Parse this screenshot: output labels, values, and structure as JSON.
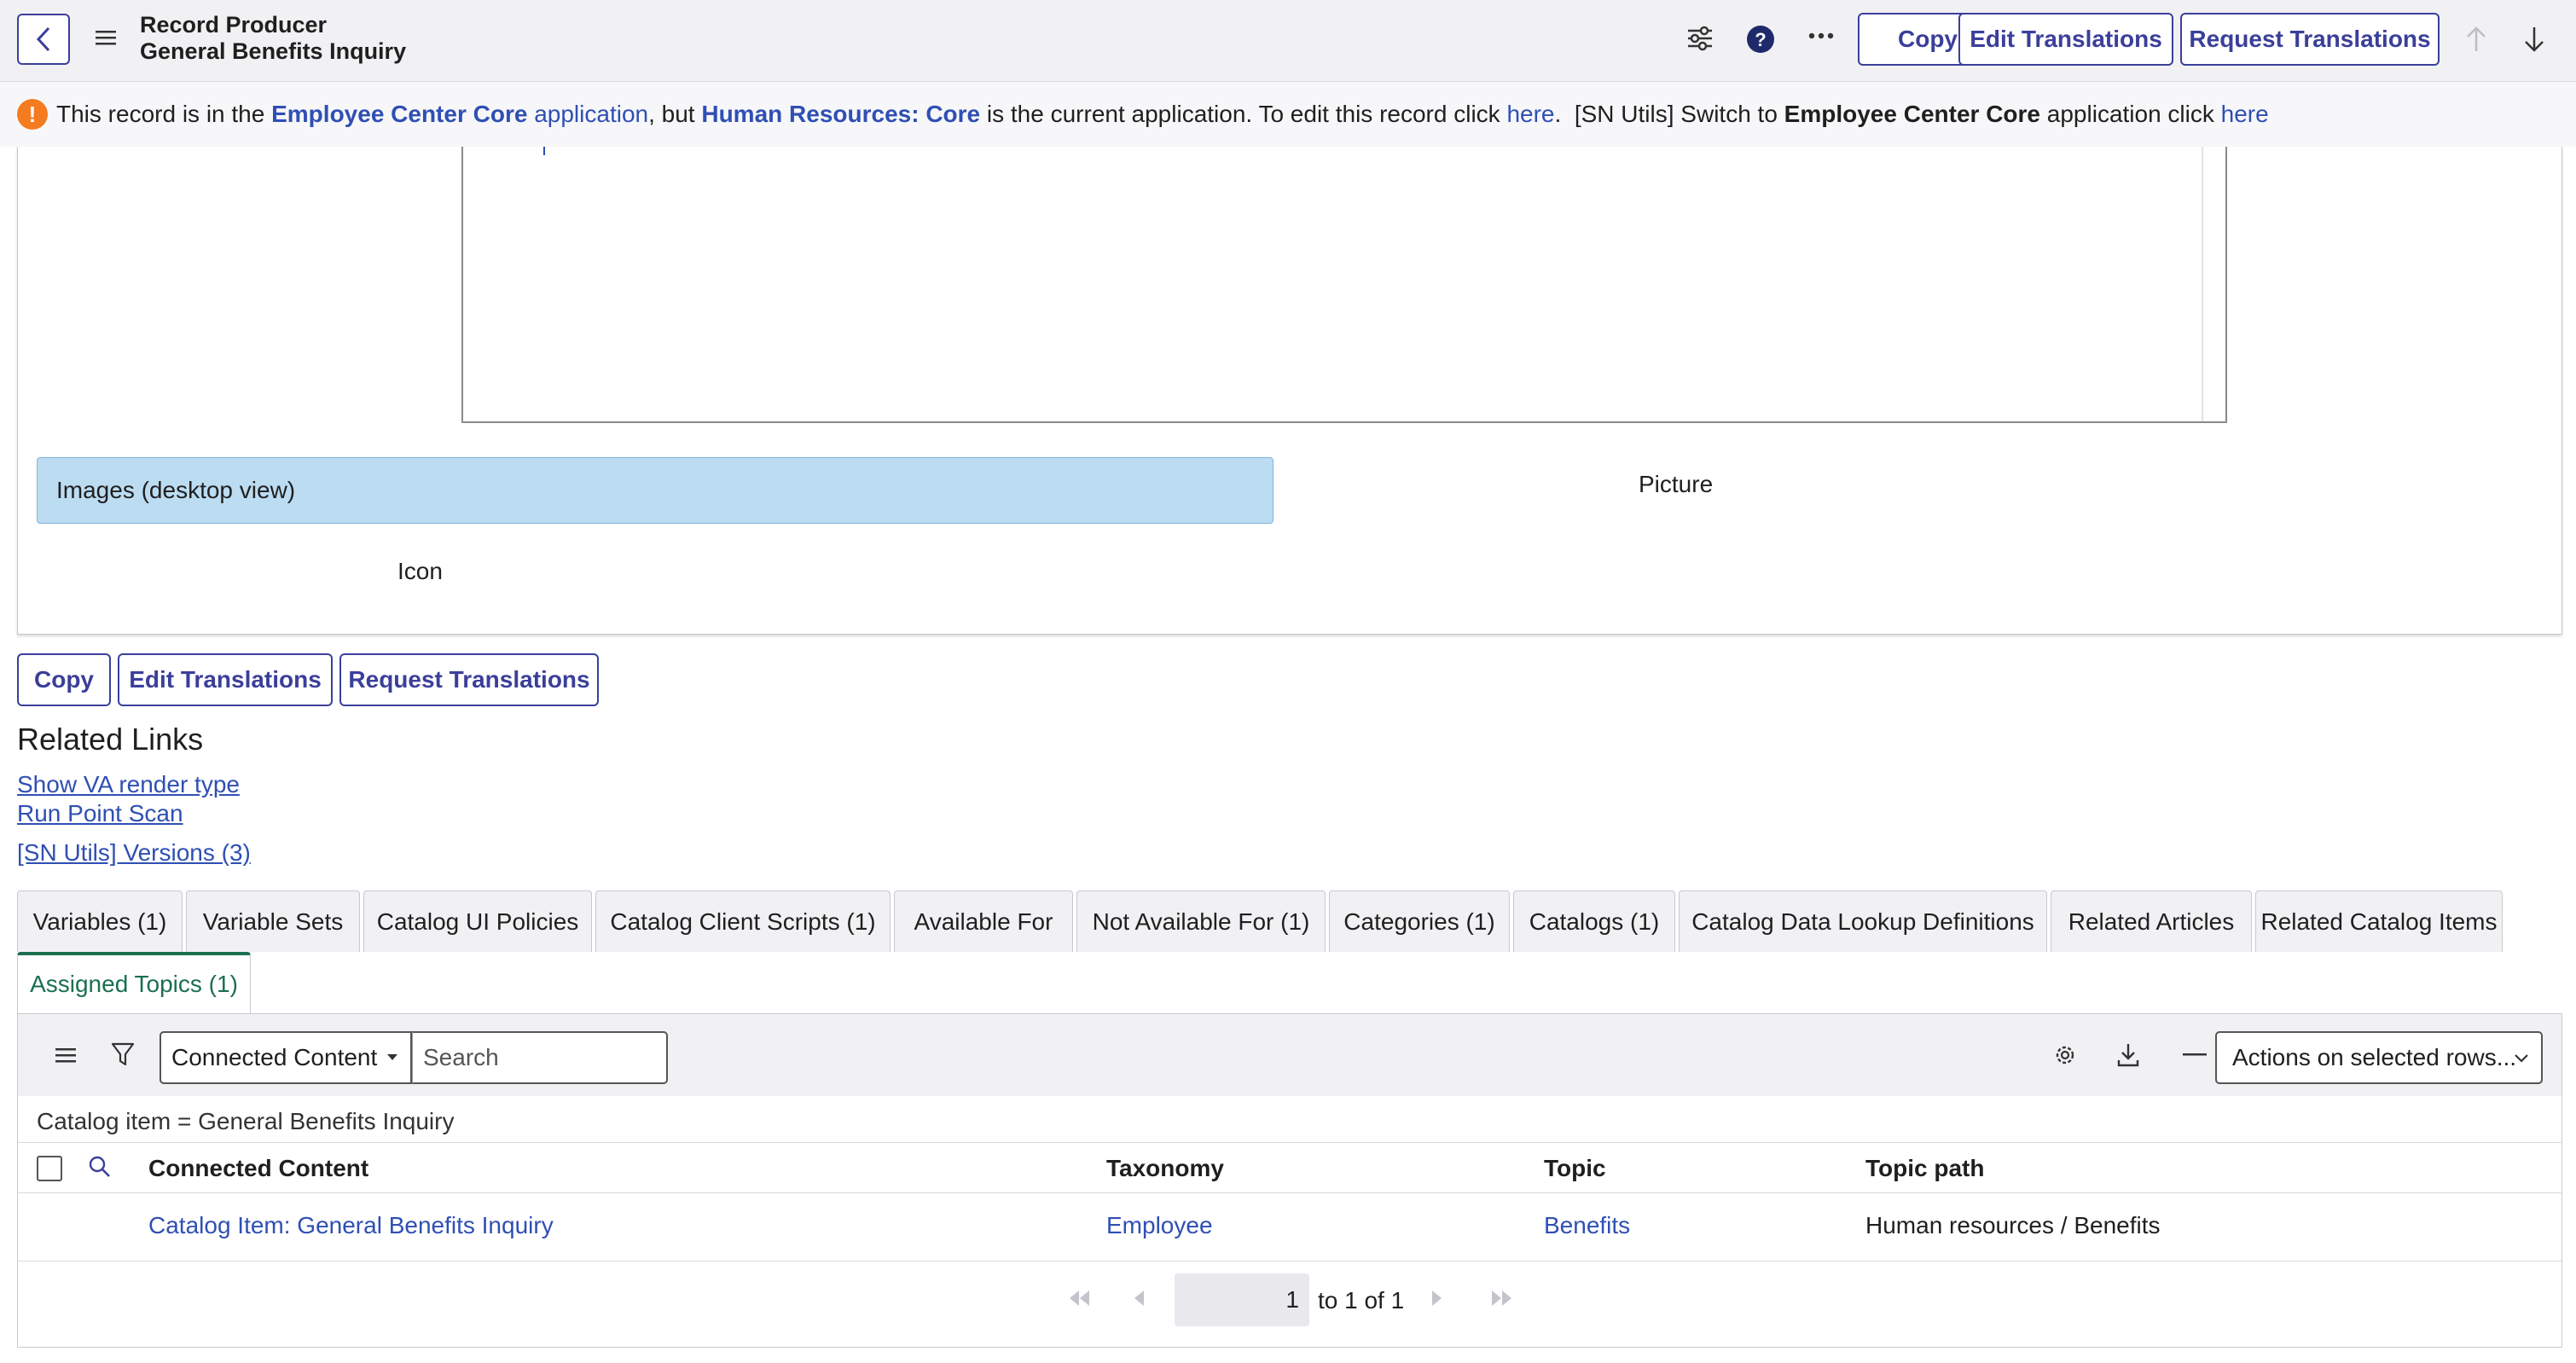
{
  "header": {
    "record_type": "Record Producer",
    "record_name": "General Benefits Inquiry",
    "buttons": {
      "copy": "Copy",
      "edit_translations": "Edit Translations",
      "request_translations": "Request Translations"
    }
  },
  "notice": {
    "icon_text": "!",
    "p1": "This record is in the ",
    "app1_bold": "Employee Center Core",
    "app1_rest": " application",
    "p2": ", but ",
    "app2": "Human Resources: Core",
    "p3": " is the current application. To edit this record click ",
    "here1": "here",
    "p4": ".  [SN Utils] Switch to ",
    "app3": "Employee Center Core",
    "p5": " application click ",
    "here2": "here"
  },
  "form": {
    "section_title": "Images (desktop view)",
    "picture_label": "Picture",
    "icon_label": "Icon"
  },
  "bottom_buttons": {
    "copy": "Copy",
    "edit_translations": "Edit Translations",
    "request_translations": "Request Translations"
  },
  "related_links": {
    "title": "Related Links",
    "items": [
      "Show VA render type",
      "Run Point Scan",
      "[SN Utils] Versions (3)"
    ]
  },
  "tabs": [
    "Variables (1)",
    "Variable Sets",
    "Catalog UI Policies",
    "Catalog Client Scripts (1)",
    "Available For",
    "Not Available For (1)",
    "Categories (1)",
    "Catalogs (1)",
    "Catalog Data Lookup Definitions",
    "Related Articles",
    "Related Catalog Items",
    "Assigned Topics (1)"
  ],
  "list": {
    "select_value": "Connected Content",
    "search_placeholder": "Search",
    "actions_label": "Actions on selected rows...",
    "breadcrumb": "Catalog item = General Benefits Inquiry",
    "columns": [
      "Connected Content",
      "Taxonomy",
      "Topic",
      "Topic path"
    ],
    "rows": [
      [
        "Catalog Item: General Benefits Inquiry",
        "Employee",
        "Benefits",
        "Human resources / Benefits"
      ]
    ],
    "pager": {
      "page": "1",
      "range": "to 1 of 1"
    }
  },
  "colors": {
    "accent": "#3b3f9a",
    "link": "#2f4fb3",
    "section": "#bcdcf2",
    "active_tab": "#1b6f4f",
    "warning": "#f47b20"
  }
}
